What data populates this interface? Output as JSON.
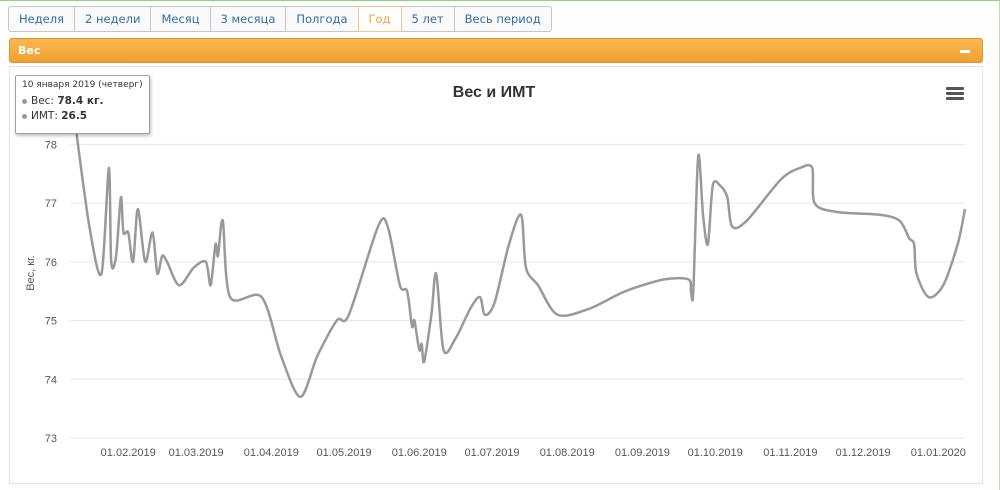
{
  "tabs": [
    {
      "label": "Неделя",
      "active": false
    },
    {
      "label": "2 недели",
      "active": false
    },
    {
      "label": "Месяц",
      "active": false
    },
    {
      "label": "3 месяца",
      "active": false
    },
    {
      "label": "Полгода",
      "active": false
    },
    {
      "label": "Год",
      "active": true
    },
    {
      "label": "5 лет",
      "active": false
    },
    {
      "label": "Весь период",
      "active": false
    }
  ],
  "panel": {
    "title": "Вес"
  },
  "colors": {
    "accent": "#f2a032",
    "line": "#999999",
    "tab_text": "#2d6ea3",
    "tab_active": "#f2a33c"
  },
  "icons": {
    "collapse": "minus-icon",
    "menu": "hamburger-menu-icon"
  },
  "tooltip": {
    "date": "10 января 2019 (четверг)",
    "weight_label": "Вес: ",
    "weight_value": "78.4 кг.",
    "bmi_label": "ИМТ: ",
    "bmi_value": "26.5"
  },
  "chart_data": {
    "type": "line",
    "title": "Вес и ИМТ",
    "ylabel": "Вес, кг.",
    "ylim": [
      73,
      78.5
    ],
    "y_ticks": [
      73,
      74,
      75,
      76,
      77,
      78
    ],
    "x_range": [
      "2019-01-08",
      "2020-01-12"
    ],
    "x_ticks": [
      {
        "date": "2019-02-01",
        "label": "01.02.2019"
      },
      {
        "date": "2019-03-01",
        "label": "01.03.2019"
      },
      {
        "date": "2019-04-01",
        "label": "01.04.2019"
      },
      {
        "date": "2019-05-01",
        "label": "01.05.2019"
      },
      {
        "date": "2019-06-01",
        "label": "01.06.2019"
      },
      {
        "date": "2019-07-01",
        "label": "01.07.2019"
      },
      {
        "date": "2019-08-01",
        "label": "01.08.2019"
      },
      {
        "date": "2019-09-01",
        "label": "01.09.2019"
      },
      {
        "date": "2019-10-01",
        "label": "01.10.2019"
      },
      {
        "date": "2019-11-01",
        "label": "01.11.2019"
      },
      {
        "date": "2019-12-01",
        "label": "01.12.2019"
      },
      {
        "date": "2020-01-01",
        "label": "01.01.2020"
      }
    ],
    "grid": true,
    "highlight": {
      "date": "2019-01-10",
      "y": 78.4
    },
    "series": [
      {
        "values": [
          [
            "2019-01-10",
            78.4
          ],
          [
            "2019-01-16",
            76.6
          ],
          [
            "2019-01-21",
            75.8
          ],
          [
            "2019-01-24",
            77.6
          ],
          [
            "2019-01-25",
            76.0
          ],
          [
            "2019-01-27",
            76.1
          ],
          [
            "2019-01-29",
            77.1
          ],
          [
            "2019-01-30",
            76.5
          ],
          [
            "2019-02-01",
            76.5
          ],
          [
            "2019-02-03",
            76.0
          ],
          [
            "2019-02-05",
            76.9
          ],
          [
            "2019-02-08",
            76.0
          ],
          [
            "2019-02-11",
            76.5
          ],
          [
            "2019-02-13",
            75.8
          ],
          [
            "2019-02-15",
            76.1
          ],
          [
            "2019-02-17",
            76.0
          ],
          [
            "2019-02-22",
            75.6
          ],
          [
            "2019-02-28",
            75.9
          ],
          [
            "2019-03-05",
            76.0
          ],
          [
            "2019-03-07",
            75.6
          ],
          [
            "2019-03-09",
            76.3
          ],
          [
            "2019-03-10",
            76.1
          ],
          [
            "2019-03-12",
            76.7
          ],
          [
            "2019-03-15",
            75.4
          ],
          [
            "2019-03-28",
            75.4
          ],
          [
            "2019-04-05",
            74.4
          ],
          [
            "2019-04-13",
            73.7
          ],
          [
            "2019-04-20",
            74.4
          ],
          [
            "2019-04-28",
            75.0
          ],
          [
            "2019-05-03",
            75.1
          ],
          [
            "2019-05-15",
            76.6
          ],
          [
            "2019-05-19",
            76.6
          ],
          [
            "2019-05-24",
            75.6
          ],
          [
            "2019-05-27",
            75.5
          ],
          [
            "2019-05-29",
            74.9
          ],
          [
            "2019-05-30",
            75.0
          ],
          [
            "2019-06-01",
            74.5
          ],
          [
            "2019-06-02",
            74.6
          ],
          [
            "2019-06-03",
            74.3
          ],
          [
            "2019-06-06",
            75.1
          ],
          [
            "2019-06-08",
            75.8
          ],
          [
            "2019-06-11",
            74.5
          ],
          [
            "2019-06-16",
            74.7
          ],
          [
            "2019-06-22",
            75.2
          ],
          [
            "2019-06-26",
            75.4
          ],
          [
            "2019-06-28",
            75.1
          ],
          [
            "2019-07-02",
            75.3
          ],
          [
            "2019-07-08",
            76.3
          ],
          [
            "2019-07-13",
            76.8
          ],
          [
            "2019-07-15",
            75.9
          ],
          [
            "2019-07-20",
            75.6
          ],
          [
            "2019-07-28",
            75.1
          ],
          [
            "2019-08-10",
            75.2
          ],
          [
            "2019-08-25",
            75.5
          ],
          [
            "2019-09-10",
            75.7
          ],
          [
            "2019-09-20",
            75.7
          ],
          [
            "2019-09-21",
            75.5
          ],
          [
            "2019-09-22",
            75.5
          ],
          [
            "2019-09-24",
            77.8
          ],
          [
            "2019-09-26",
            76.8
          ],
          [
            "2019-09-28",
            76.3
          ],
          [
            "2019-09-30",
            77.3
          ],
          [
            "2019-10-03",
            77.3
          ],
          [
            "2019-10-06",
            77.1
          ],
          [
            "2019-10-08",
            76.6
          ],
          [
            "2019-10-14",
            76.7
          ],
          [
            "2019-10-28",
            77.4
          ],
          [
            "2019-11-05",
            77.6
          ],
          [
            "2019-11-10",
            77.6
          ],
          [
            "2019-11-11",
            77.0
          ],
          [
            "2019-11-20",
            76.85
          ],
          [
            "2019-12-08",
            76.8
          ],
          [
            "2019-12-16",
            76.7
          ],
          [
            "2019-12-20",
            76.4
          ],
          [
            "2019-12-22",
            76.3
          ],
          [
            "2019-12-23",
            75.8
          ],
          [
            "2019-12-28",
            75.4
          ],
          [
            "2020-01-03",
            75.6
          ],
          [
            "2020-01-09",
            76.3
          ],
          [
            "2020-01-12",
            76.9
          ]
        ]
      }
    ]
  }
}
